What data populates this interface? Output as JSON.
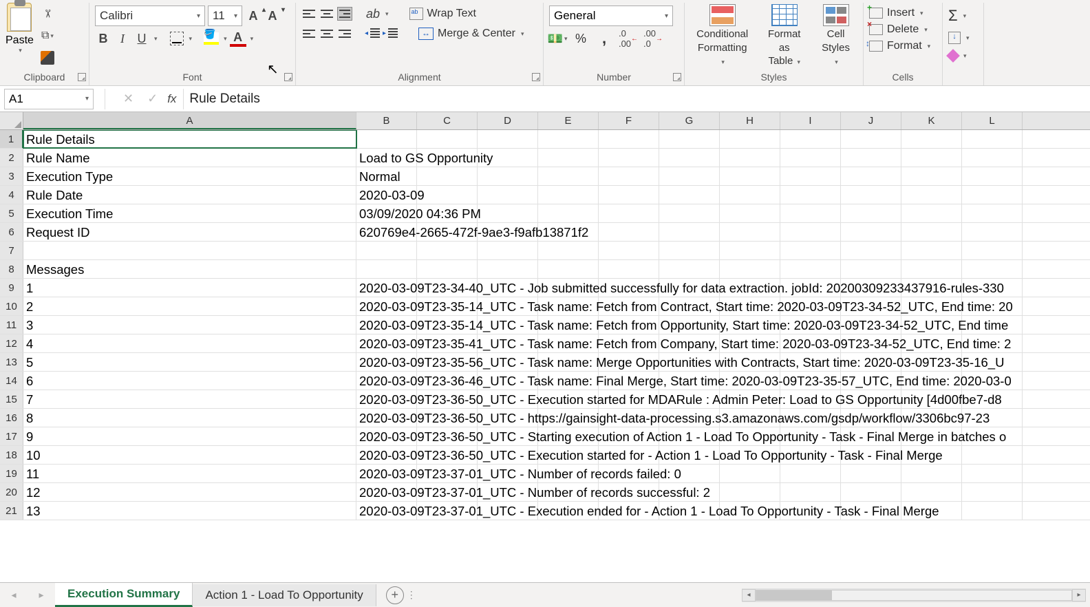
{
  "ribbon": {
    "clipboard": {
      "label": "Clipboard",
      "paste": "Paste"
    },
    "font": {
      "label": "Font",
      "name": "Calibri",
      "size": "11",
      "bold": "B",
      "italic": "I",
      "underline": "U",
      "inc": "A",
      "dec": "A"
    },
    "alignment": {
      "label": "Alignment",
      "wrap": "Wrap Text",
      "merge": "Merge & Center"
    },
    "number": {
      "label": "Number",
      "format": "General",
      "pct": "%",
      "comma": ","
    },
    "styles": {
      "label": "Styles",
      "cond1": "Conditional",
      "cond2": "Formatting",
      "tbl1": "Format as",
      "tbl2": "Table",
      "cell1": "Cell",
      "cell2": "Styles"
    },
    "cells": {
      "label": "Cells",
      "insert": "Insert",
      "delete": "Delete",
      "format": "Format"
    },
    "editing": {
      "sigma": "Σ"
    }
  },
  "formula_bar": {
    "name_box": "A1",
    "fx": "fx",
    "value": "Rule Details"
  },
  "columns": [
    "A",
    "B",
    "C",
    "D",
    "E",
    "F",
    "G",
    "H",
    "I",
    "J",
    "K",
    "L"
  ],
  "rows": [
    {
      "n": "1",
      "a": "Rule Details",
      "b": ""
    },
    {
      "n": "2",
      "a": "Rule Name",
      "b": "Load to GS Opportunity"
    },
    {
      "n": "3",
      "a": "Execution Type",
      "b": "Normal"
    },
    {
      "n": "4",
      "a": "Rule Date",
      "b": "2020-03-09"
    },
    {
      "n": "5",
      "a": "Execution Time",
      "b": "03/09/2020 04:36 PM"
    },
    {
      "n": "6",
      "a": "Request ID",
      "b": "620769e4-2665-472f-9ae3-f9afb13871f2"
    },
    {
      "n": "7",
      "a": "",
      "b": ""
    },
    {
      "n": "8",
      "a": "Messages",
      "b": ""
    },
    {
      "n": "9",
      "a": "1",
      "b": "2020-03-09T23-34-40_UTC - Job submitted successfully for data extraction. jobId: 20200309233437916-rules-330"
    },
    {
      "n": "10",
      "a": "2",
      "b": "2020-03-09T23-35-14_UTC - Task name: Fetch from Contract, Start time: 2020-03-09T23-34-52_UTC, End time: 20"
    },
    {
      "n": "11",
      "a": "3",
      "b": "2020-03-09T23-35-14_UTC - Task name: Fetch from Opportunity, Start time: 2020-03-09T23-34-52_UTC, End time"
    },
    {
      "n": "12",
      "a": "4",
      "b": "2020-03-09T23-35-41_UTC - Task name: Fetch from Company, Start time: 2020-03-09T23-34-52_UTC, End time: 2"
    },
    {
      "n": "13",
      "a": "5",
      "b": "2020-03-09T23-35-56_UTC - Task name: Merge Opportunities with Contracts, Start time: 2020-03-09T23-35-16_U"
    },
    {
      "n": "14",
      "a": "6",
      "b": "2020-03-09T23-36-46_UTC - Task name: Final Merge, Start time: 2020-03-09T23-35-57_UTC, End time: 2020-03-0"
    },
    {
      "n": "15",
      "a": "7",
      "b": "2020-03-09T23-36-50_UTC - Execution started for MDARule : Admin Peter: Load to GS Opportunity [4d00fbe7-d8"
    },
    {
      "n": "16",
      "a": "8",
      "b": "2020-03-09T23-36-50_UTC - https://gainsight-data-processing.s3.amazonaws.com/gsdp/workflow/3306bc97-23"
    },
    {
      "n": "17",
      "a": "9",
      "b": "2020-03-09T23-36-50_UTC - Starting execution of Action 1 - Load To Opportunity - Task - Final Merge in batches o"
    },
    {
      "n": "18",
      "a": "10",
      "b": "2020-03-09T23-36-50_UTC - Execution started for - Action 1 - Load To Opportunity - Task - Final Merge"
    },
    {
      "n": "19",
      "a": "11",
      "b": "2020-03-09T23-37-01_UTC - Number of records failed: 0"
    },
    {
      "n": "20",
      "a": "12",
      "b": "2020-03-09T23-37-01_UTC - Number of records successful: 2"
    },
    {
      "n": "21",
      "a": "13",
      "b": "2020-03-09T23-37-01_UTC - Execution ended for - Action 1 - Load To Opportunity - Task - Final Merge"
    }
  ],
  "sheets": {
    "active": "Execution Summary",
    "other": "Action 1 - Load To Opportunity"
  }
}
